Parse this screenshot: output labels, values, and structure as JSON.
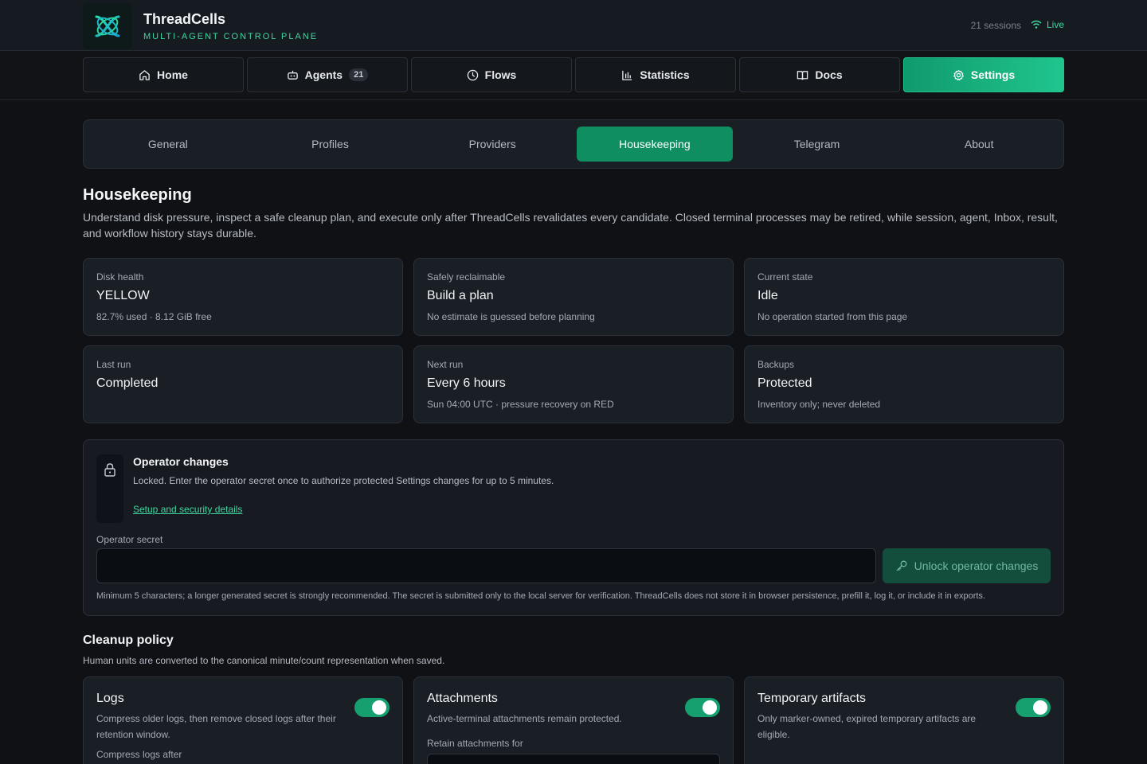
{
  "app": {
    "name": "ThreadCells",
    "subtitle": "MULTI-AGENT CONTROL PLANE",
    "sessions": "21 sessions",
    "live": "Live"
  },
  "nav": {
    "home": "Home",
    "agents": "Agents",
    "agents_count": "21",
    "flows": "Flows",
    "statistics": "Statistics",
    "docs": "Docs",
    "settings": "Settings"
  },
  "tabs": [
    "General",
    "Profiles",
    "Providers",
    "Housekeeping",
    "Telegram",
    "About"
  ],
  "housekeeping": {
    "title": "Housekeeping",
    "description": "Understand disk pressure, inspect a safe cleanup plan, and execute only after ThreadCells revalidates every candidate. Closed terminal processes may be retired, while session, agent, Inbox, result, and workflow history stays durable."
  },
  "cards": [
    {
      "label": "Disk health",
      "value": "YELLOW",
      "note": "82.7% used · 8.12 GiB free"
    },
    {
      "label": "Safely reclaimable",
      "value": "Build a plan",
      "note": "No estimate is guessed before planning"
    },
    {
      "label": "Current state",
      "value": "Idle",
      "note": "No operation started from this page"
    },
    {
      "label": "Last run",
      "value": "Completed",
      "note": ""
    },
    {
      "label": "Next run",
      "value": "Every 6 hours",
      "note": "Sun 04:00 UTC · pressure recovery on RED"
    },
    {
      "label": "Backups",
      "value": "Protected",
      "note": "Inventory only; never deleted"
    }
  ],
  "operator": {
    "title": "Operator changes",
    "description": "Locked. Enter the operator secret once to authorize protected Settings changes for up to 5 minutes.",
    "link": "Setup and security details",
    "field_label": "Operator secret",
    "field_value": "",
    "button": "Unlock operator changes",
    "help": "Minimum 5 characters; a longer generated secret is strongly recommended. The secret is submitted only to the local server for verification. ThreadCells does not store it in browser persistence, prefill it, log it, or include it in exports."
  },
  "cleanup": {
    "title": "Cleanup policy",
    "description": "Human units are converted to the canonical minute/count representation when saved.",
    "items": [
      {
        "title": "Logs",
        "description": "Compress older logs, then remove closed logs after their retention window.",
        "field": "Compress logs after",
        "enabled": true
      },
      {
        "title": "Attachments",
        "description": "Active-terminal attachments remain protected.",
        "field": "Retain attachments for",
        "enabled": true
      },
      {
        "title": "Temporary artifacts",
        "description": "Only marker-owned, expired temporary artifacts are eligible.",
        "field": "",
        "enabled": true
      }
    ]
  },
  "colors": {
    "accent": "#20c58e",
    "background": "#0f1115",
    "card": "#1a1e25"
  }
}
